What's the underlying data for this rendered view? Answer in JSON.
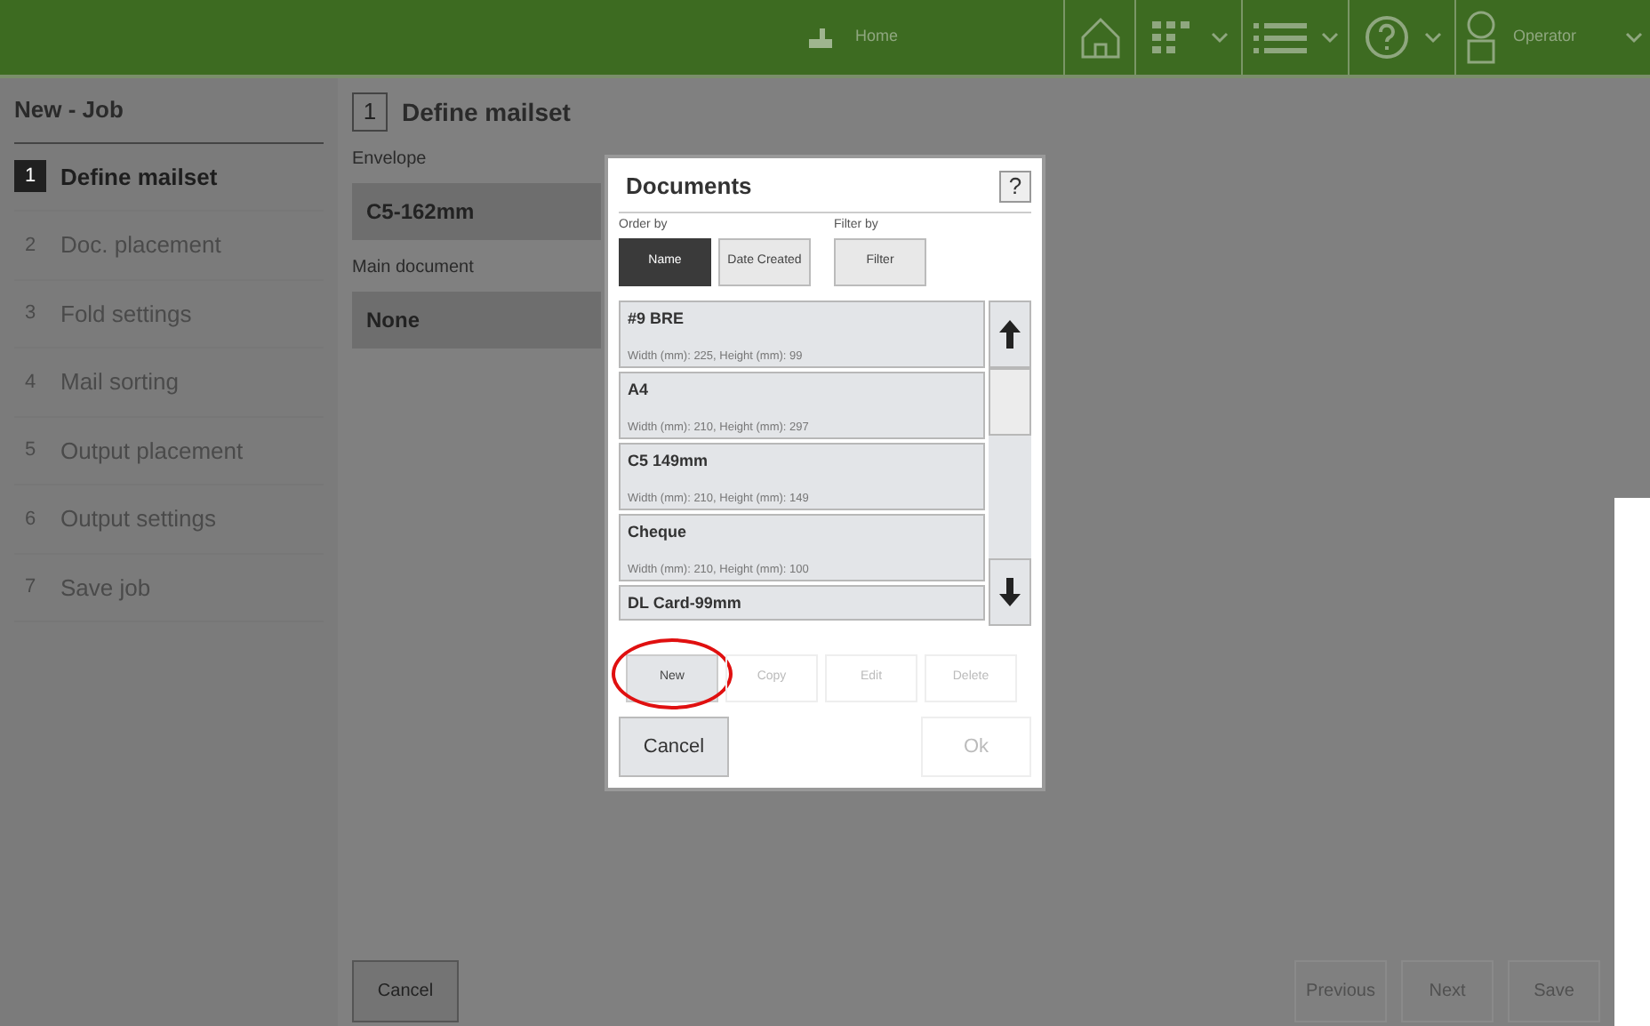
{
  "header": {
    "logo_label": "Home",
    "user": "Operator"
  },
  "sidebar": {
    "title": "New - Job",
    "steps": [
      {
        "number": "1",
        "label": "Define mailset",
        "selected": true
      },
      {
        "number": "2",
        "label": "Doc. placement",
        "selected": false
      },
      {
        "number": "3",
        "label": "Fold settings",
        "selected": false
      },
      {
        "number": "4",
        "label": "Mail sorting",
        "selected": false
      },
      {
        "number": "5",
        "label": "Output placement",
        "selected": false
      },
      {
        "number": "6",
        "label": "Output settings",
        "selected": false
      },
      {
        "number": "7",
        "label": "Save job",
        "selected": false
      }
    ]
  },
  "main": {
    "step_number": "1",
    "step_title": "Define mailset",
    "fields": [
      {
        "label": "Envelope",
        "value": "C5-162mm"
      },
      {
        "label": "Main document",
        "value": "None"
      }
    ]
  },
  "dialog": {
    "title": "Documents",
    "help": "?",
    "order_label": "Order by",
    "filter_label": "Filter by",
    "order_buttons": [
      {
        "label": "Name",
        "selected": true
      },
      {
        "label": "Date Created",
        "selected": false
      }
    ],
    "filter_button": "Filter",
    "documents": [
      {
        "name": "#9 BRE",
        "details": "Width (mm): 225, Height (mm): 99"
      },
      {
        "name": "A4",
        "details": "Width (mm): 210, Height (mm): 297"
      },
      {
        "name": "C5 149mm",
        "details": "Width (mm): 210, Height (mm): 149"
      },
      {
        "name": "Cheque",
        "details": "Width (mm): 210, Height (mm): 100"
      },
      {
        "name": "DL Card-99mm"
      }
    ],
    "actions": [
      {
        "label": "New",
        "disabled": false,
        "highlighted": true
      },
      {
        "label": "Copy",
        "disabled": true,
        "highlighted": false
      },
      {
        "label": "Edit",
        "disabled": true,
        "highlighted": false
      },
      {
        "label": "Delete",
        "disabled": true,
        "highlighted": false
      }
    ],
    "cancel": "Cancel",
    "ok": {
      "label": "Ok",
      "disabled": true
    }
  },
  "footer": {
    "buttons": [
      {
        "label": "Cancel",
        "disabled": false
      },
      {
        "label": "Previous",
        "disabled": true
      },
      {
        "label": "Next",
        "disabled": true
      },
      {
        "label": "Save",
        "disabled": true
      }
    ]
  }
}
